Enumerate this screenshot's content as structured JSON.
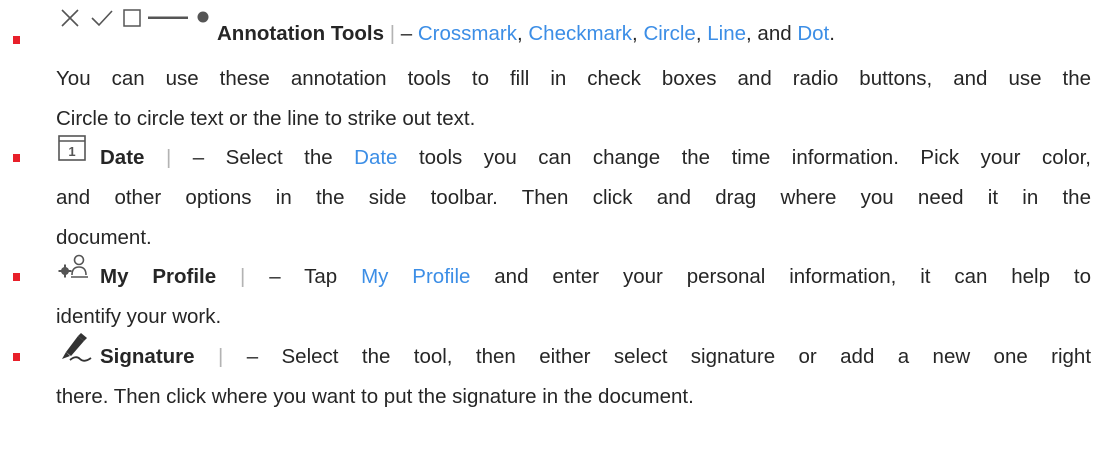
{
  "items": [
    {
      "title": "Annotation Tools",
      "sep": "|",
      "dash": "–",
      "links": [
        "Crossmark",
        "Checkmark",
        "Circle",
        "Line",
        "Dot"
      ],
      "comma": ",",
      "and_text": "and",
      "period": ".",
      "lines": [
        "You can use these annotation tools to fill in check boxes and radio buttons, and use the",
        "Circle to circle text or the line to strike out text."
      ],
      "icons": [
        "crossmark-icon",
        "checkmark-icon",
        "square-icon",
        "line-icon",
        "dot-icon"
      ]
    },
    {
      "title": "Date",
      "sep": "|",
      "dash": "–",
      "pre": "Select the",
      "link": "Date",
      "post": "tools you can change the time information. Pick your color,",
      "lines": [
        "and other options in the side toolbar. Then click and drag where you need it in the",
        "document."
      ],
      "icon_text": "1"
    },
    {
      "title": "My Profile",
      "sep": "|",
      "dash": "–",
      "pre": "Tap",
      "link": "My Profile",
      "post": "and enter your personal information, it can help to",
      "lines": [
        "identify your work."
      ]
    },
    {
      "title": "Signature",
      "sep": "|",
      "dash": "–",
      "post": "Select the tool, then either select signature or add a new one right",
      "lines": [
        "there. Then click where you want to put the signature in the document."
      ]
    }
  ],
  "colors": {
    "bullet": "#e8202a",
    "link": "#3c8ee6",
    "text": "#262626",
    "icon": "#555555"
  }
}
